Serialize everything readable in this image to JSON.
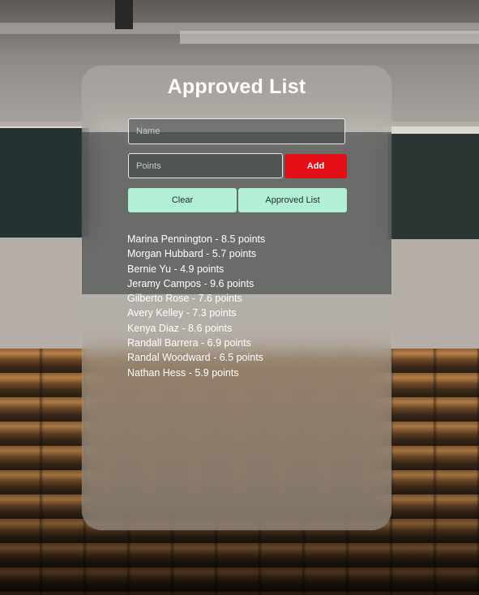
{
  "title": "Approved List",
  "form": {
    "name_placeholder": "Name",
    "name_value": "",
    "points_placeholder": "Points",
    "points_value": "",
    "add_label": "Add",
    "clear_label": "Clear",
    "approved_list_label": "Approved List"
  },
  "entries": [
    "Marina Pennington - 8.5 points",
    "Morgan Hubbard - 5.7 points",
    "Bernie Yu - 4.9 points",
    "Jeramy Campos - 9.6 points",
    "Gilberto Rose - 7.6 points",
    "Avery Kelley - 7.3 points",
    "Kenya Diaz - 8.6 points",
    "Randall Barrera - 6.9 points",
    "Randal Woodward - 6.5 points",
    "Nathan Hess - 5.9 points"
  ],
  "colors": {
    "add_button": "#e40f16",
    "secondary_button": "#b1f0d4",
    "text": "#ffffff"
  }
}
